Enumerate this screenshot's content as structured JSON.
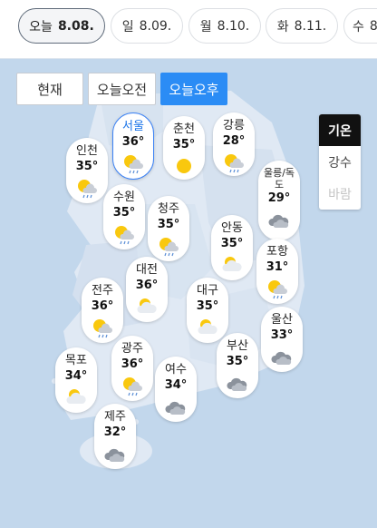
{
  "date_tabs": [
    {
      "day": "오늘",
      "date": "8.08.",
      "active": true
    },
    {
      "day": "일",
      "date": "8.09.",
      "active": false
    },
    {
      "day": "월",
      "date": "8.10.",
      "active": false
    },
    {
      "day": "화",
      "date": "8.11.",
      "active": false
    },
    {
      "day": "수",
      "date": "8.",
      "active": false
    }
  ],
  "time_buttons": [
    "현재",
    "오늘오전",
    "오늘오후"
  ],
  "active_time": "오늘오후",
  "modes": [
    "기온",
    "강수",
    "바람"
  ],
  "active_mode": "기온",
  "cities": [
    {
      "name": "서울",
      "temp": "36°",
      "icon": "sun-rain-icon",
      "selected": true
    },
    {
      "name": "춘천",
      "temp": "35°",
      "icon": "sun-icon"
    },
    {
      "name": "강릉",
      "temp": "28°",
      "icon": "sun-rain-icon"
    },
    {
      "name": "인천",
      "temp": "35°",
      "icon": "sun-rain-icon"
    },
    {
      "name": "울릉/독도",
      "temp": "29°",
      "icon": "cloud-icon"
    },
    {
      "name": "수원",
      "temp": "35°",
      "icon": "sun-rain-icon"
    },
    {
      "name": "청주",
      "temp": "35°",
      "icon": "sun-rain-icon"
    },
    {
      "name": "안동",
      "temp": "35°",
      "icon": "partly-cloudy-icon"
    },
    {
      "name": "대전",
      "temp": "36°",
      "icon": "partly-cloudy-icon"
    },
    {
      "name": "포항",
      "temp": "31°",
      "icon": "sun-rain-icon"
    },
    {
      "name": "전주",
      "temp": "36°",
      "icon": "sun-rain-icon"
    },
    {
      "name": "대구",
      "temp": "35°",
      "icon": "partly-cloudy-icon"
    },
    {
      "name": "울산",
      "temp": "33°",
      "icon": "cloud-icon"
    },
    {
      "name": "광주",
      "temp": "36°",
      "icon": "sun-rain-icon"
    },
    {
      "name": "부산",
      "temp": "35°",
      "icon": "cloud-icon"
    },
    {
      "name": "목포",
      "temp": "34°",
      "icon": "partly-cloudy-icon"
    },
    {
      "name": "여수",
      "temp": "34°",
      "icon": "cloud-icon"
    },
    {
      "name": "제주",
      "temp": "32°",
      "icon": "cloud-icon"
    }
  ]
}
